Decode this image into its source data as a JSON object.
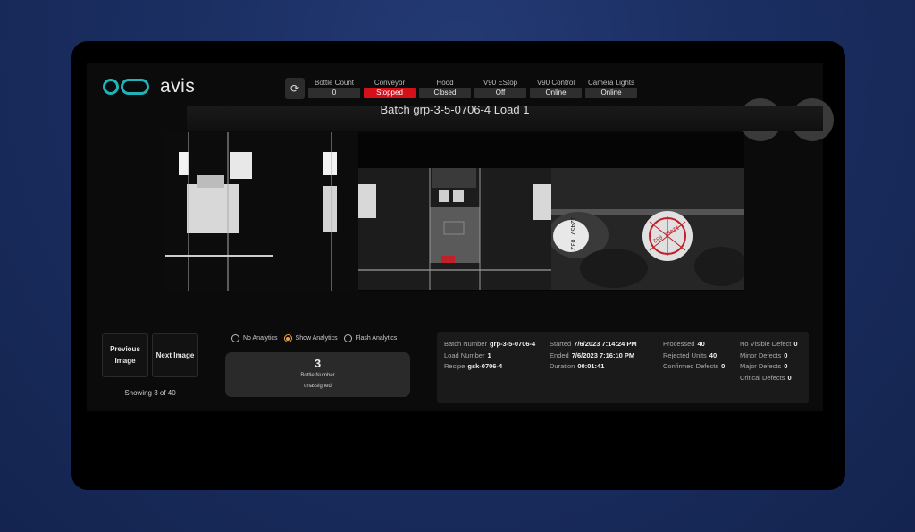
{
  "brand": "avis",
  "status_items": [
    {
      "label": "Bottle Count",
      "value": "0",
      "color": "#2e2e2e"
    },
    {
      "label": "Conveyor",
      "value": "Stopped",
      "color": "#d4111b"
    },
    {
      "label": "Hood",
      "value": "Closed",
      "color": "#2e2e2e"
    },
    {
      "label": "V90 EStop",
      "value": "Off",
      "color": "#2e2e2e"
    },
    {
      "label": "V90 Control",
      "value": "Online",
      "color": "#2e2e2e"
    },
    {
      "label": "Camera Lights",
      "value": "Online",
      "color": "#2e2e2e"
    }
  ],
  "batch_title": "Batch grp-3-5-0706-4 Load 1",
  "nav": {
    "previous": "Previous Image",
    "next": "Next Image",
    "showing": "Showing 3 of 40"
  },
  "analytics": {
    "options": [
      "No Analytics",
      "Show Analytics",
      "Flash Analytics"
    ],
    "selected": "Show Analytics"
  },
  "bottle": {
    "number": "3",
    "label": "Bottle Number",
    "assignment": "unassigned"
  },
  "stats": {
    "batch_number": {
      "label": "Batch Number",
      "value": "grp-3-5-0706-4"
    },
    "load_number": {
      "label": "Load Number",
      "value": "1"
    },
    "recipe": {
      "label": "Recipe",
      "value": "gsk-0706-4"
    },
    "started": {
      "label": "Started",
      "value": "7/6/2023 7:14:24 PM"
    },
    "ended": {
      "label": "Ended",
      "value": "7/6/2023 7:16:10 PM"
    },
    "duration": {
      "label": "Duration",
      "value": "00:01:41"
    },
    "processed": {
      "label": "Processed",
      "value": "40"
    },
    "rejected": {
      "label": "Rejected Units",
      "value": "40"
    },
    "confirmed": {
      "label": "Confirmed Defects",
      "value": "0"
    },
    "no_visible": {
      "label": "No Visible Defect",
      "value": "0"
    },
    "minor": {
      "label": "Minor Defects",
      "value": "0"
    },
    "major": {
      "label": "Major Defects",
      "value": "0"
    },
    "critical": {
      "label": "Critical Defects",
      "value": "0"
    }
  },
  "image_labels": {
    "bottle_a_text": "12457 032",
    "bottle_b_text": "12457 032"
  },
  "icons": {
    "refresh": "refresh-icon",
    "play": "play-icon",
    "stop": "stop-icon"
  }
}
